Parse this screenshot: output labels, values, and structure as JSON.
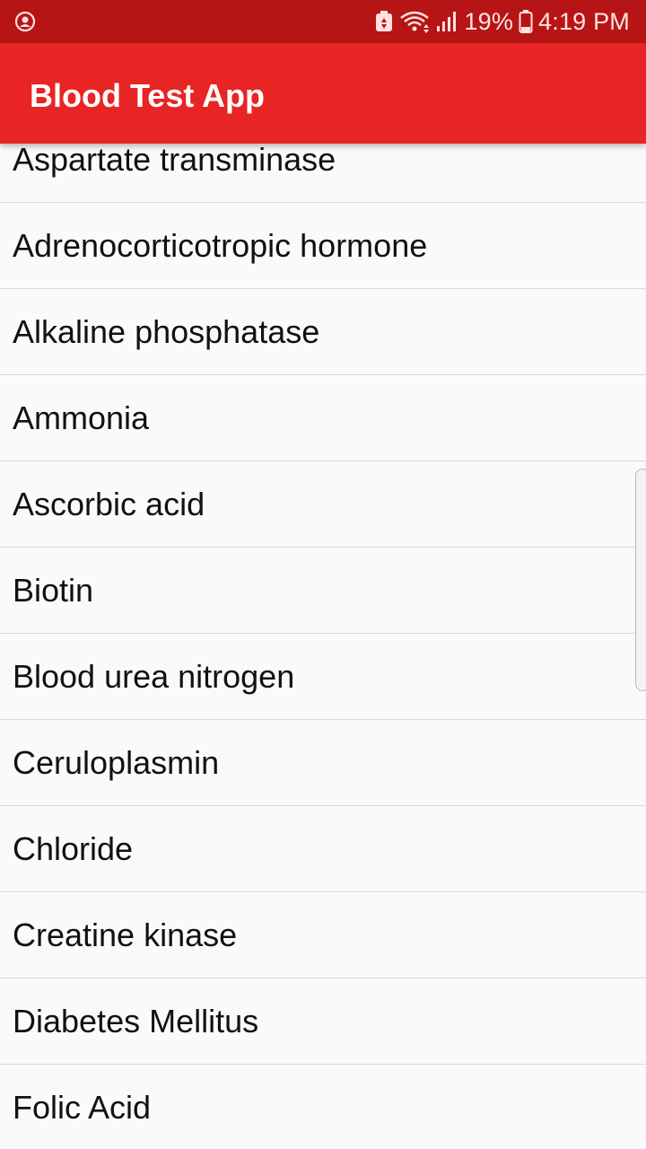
{
  "status_bar": {
    "battery_percent": "19%",
    "time": "4:19 PM",
    "icons": [
      "account-circle-icon",
      "battery-saver-icon",
      "wifi-icon",
      "signal-icon",
      "battery-icon"
    ]
  },
  "app_bar": {
    "title": "Blood Test App",
    "color": "#e82424"
  },
  "list": {
    "items": [
      {
        "label": "Aspartate transminase"
      },
      {
        "label": "Adrenocorticotropic hormone"
      },
      {
        "label": "Alkaline phosphatase"
      },
      {
        "label": "Ammonia"
      },
      {
        "label": "Ascorbic acid"
      },
      {
        "label": "Biotin"
      },
      {
        "label": "Blood urea nitrogen"
      },
      {
        "label": "Ceruloplasmin"
      },
      {
        "label": "Chloride"
      },
      {
        "label": "Creatine kinase"
      },
      {
        "label": "Diabetes Mellitus"
      },
      {
        "label": "Folic Acid"
      }
    ]
  }
}
